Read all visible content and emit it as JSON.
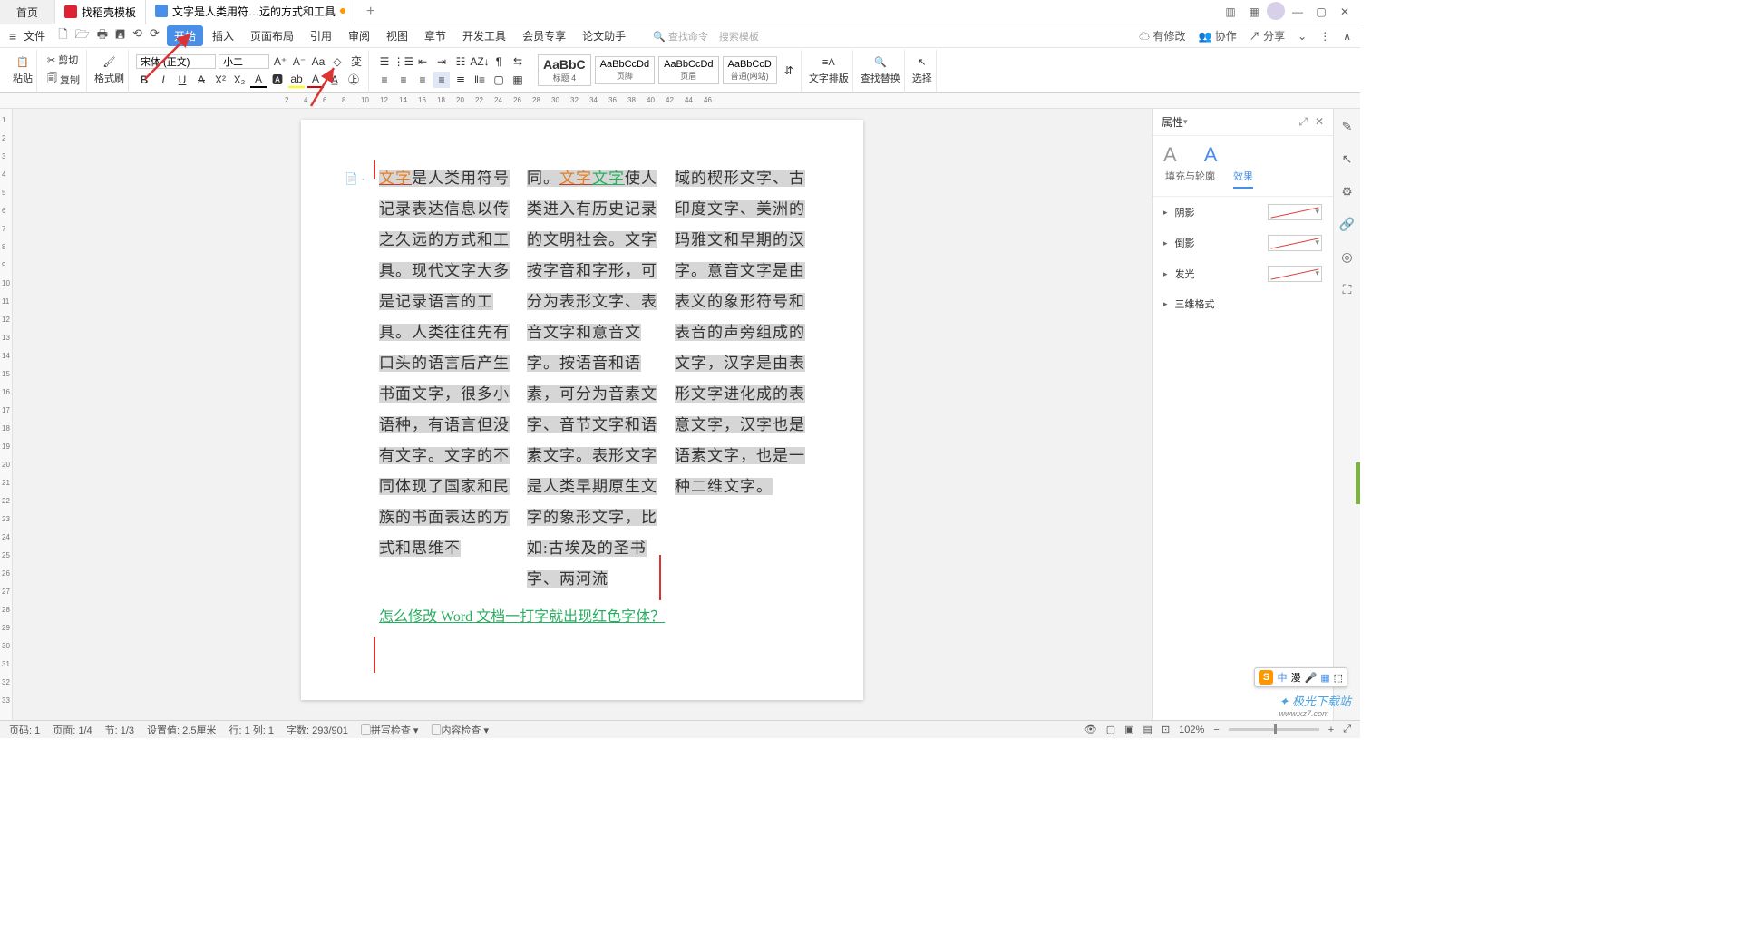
{
  "tabs": {
    "home": "首页",
    "t1": "找稻壳模板",
    "t2": "文字是人类用符…远的方式和工具",
    "plus": "+"
  },
  "winctrl": {
    "grid1": "▥",
    "grid2": "▦",
    "min": "—",
    "max": "▢",
    "close": "✕"
  },
  "menu": {
    "hamb": "≡",
    "file": "文件",
    "items": [
      "开始",
      "插入",
      "页面布局",
      "引用",
      "审阅",
      "视图",
      "章节",
      "开发工具",
      "会员专享",
      "论文助手"
    ],
    "quick": [
      "🗋",
      "🗁",
      "🖶",
      "🖪",
      "⟲",
      "⟳"
    ],
    "search1": "查找命令",
    "search2": "搜索模板",
    "right": {
      "track": "有修改",
      "coop": "协作",
      "share": "分享"
    }
  },
  "ribbon": {
    "paste": "粘贴",
    "cut": "剪切",
    "copy": "复制",
    "brush": "格式刷",
    "font": "宋体 (正文)",
    "size": "小二",
    "styles": [
      {
        "s": "AaBbC",
        "l": "标题 4"
      },
      {
        "s": "AaBbCcDd",
        "l": "页脚"
      },
      {
        "s": "AaBbCcDd",
        "l": "页眉"
      },
      {
        "s": "AaBbCcD",
        "l": "普通(网站)"
      }
    ],
    "layout": "文字排版",
    "find": "查找替换",
    "select": "选择"
  },
  "ruler": {
    "h": [
      "2",
      "4",
      "6",
      "8",
      "10",
      "12",
      "14",
      "16",
      "18",
      "20",
      "22",
      "24",
      "26",
      "28",
      "30",
      "32",
      "34",
      "36",
      "38",
      "40",
      "42",
      "44",
      "46"
    ]
  },
  "vruler": [
    "1",
    "2",
    "3",
    "4",
    "5",
    "6",
    "7",
    "8",
    "9",
    "10",
    "11",
    "12",
    "13",
    "14",
    "15",
    "16",
    "17",
    "18",
    "19",
    "20",
    "21",
    "22",
    "23",
    "24",
    "25",
    "26",
    "27",
    "28",
    "29",
    "30",
    "31",
    "32",
    "33"
  ],
  "doc": {
    "c1a": "文字",
    "c1b": "是人类用符号记录表达信息以传之久远的方式和工具。现代文字大多是记录语言的工具。人类往往先有口头的语言后产生书面文字，很多小语种，有语言但没有文字。文字的不同体现了国家和民族的书面表达的方式和思维不",
    "c2a": "同。",
    "c2b": "文字",
    "c2c": "文字",
    "c2d": "使人类进入有历史记录的文明社会。文字按字音和字形，可分为表形文字、表音文字和意音文字。按语音和语素，可分为音素文字、音节文字和语素文字。表形文字是人类早期原生文字的象形文字，比如:古埃及的圣书字、两河流",
    "c3": "域的楔形文字、古印度文字、美洲的玛雅文和早期的汉字。意音文字是由表义的象形符号和表音的声旁组成的文字，汉字是由表形文字进化成的表意文字，汉字也是语素文字，也是一种二维文字。",
    "link": "怎么修改 Word 文档一打字就出现红色字体？"
  },
  "props": {
    "title": "属性",
    "tab1": "填充与轮廓",
    "tab2": "效果",
    "rows": [
      "阴影",
      "倒影",
      "发光",
      "三维格式"
    ]
  },
  "status": {
    "l": [
      "页码: 1",
      "页面: 1/4",
      "节: 1/3",
      "设置值: 2.5厘米",
      "行: 1  列: 1",
      "字数: 293/901",
      "拼写检查",
      "内容检查"
    ],
    "zoom": "102%"
  },
  "ime": {
    "s": "S",
    "txt": "中",
    "items": [
      "漫",
      "🎤",
      "▦",
      "⬚"
    ]
  },
  "wm": {
    "t": "极光下载站",
    "s": "www.xz7.com"
  }
}
